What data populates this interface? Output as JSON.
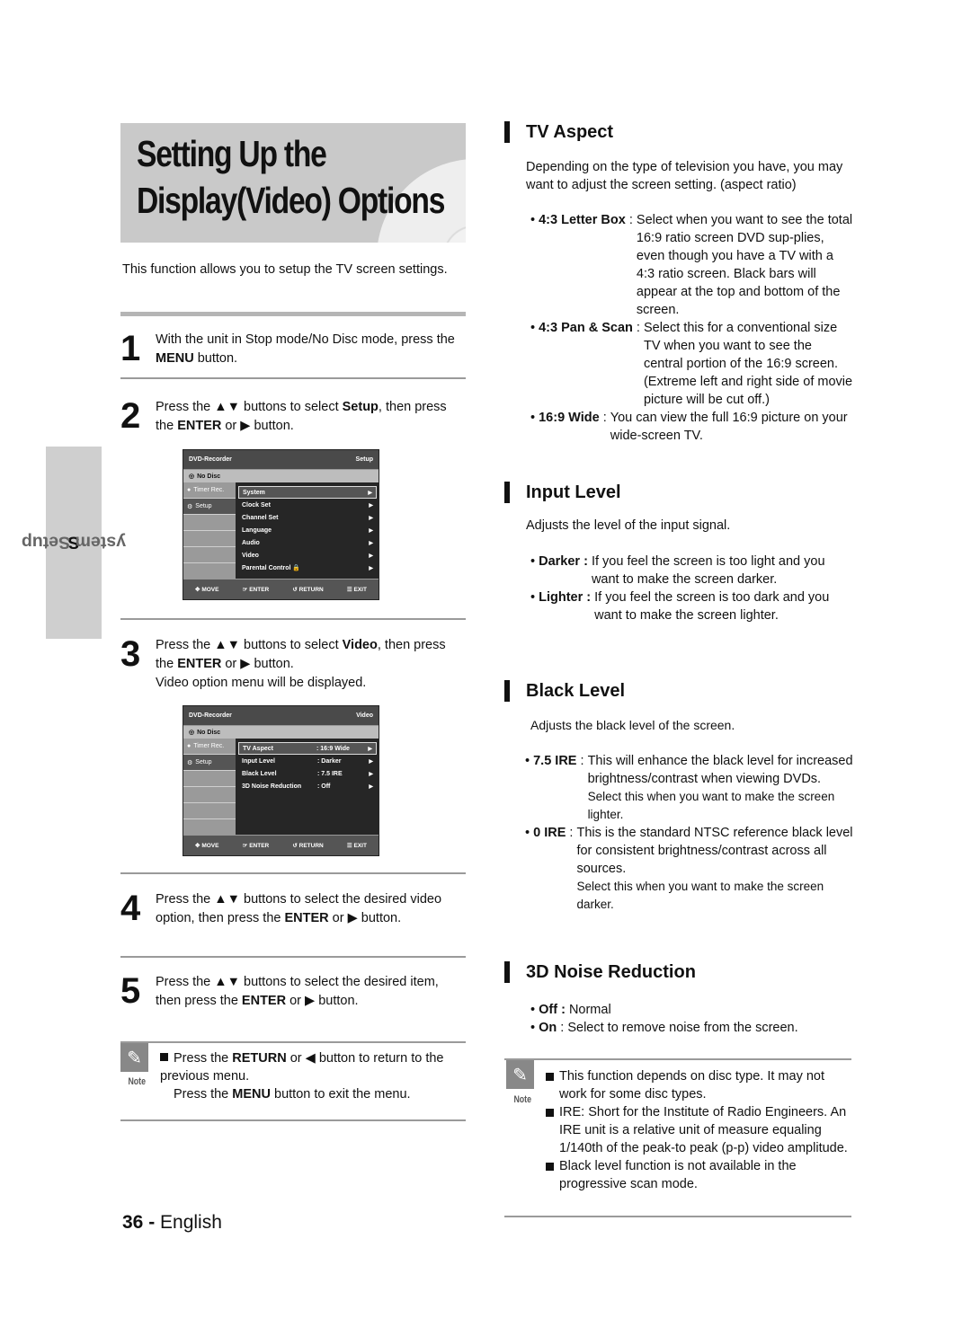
{
  "title": {
    "line1": "Setting Up the",
    "line2": "Display(Video) Options"
  },
  "intro": "This function allows you to setup the TV screen settings.",
  "side_tab": {
    "first_letter": "S",
    "rest": "ystem Setup"
  },
  "steps": [
    {
      "num": "1",
      "parts": [
        [
          "With the unit in Stop mode/No Disc mode, press the ",
          false
        ],
        [
          "MENU",
          true
        ],
        [
          " button.",
          false
        ]
      ]
    },
    {
      "num": "2",
      "parts": [
        [
          "Press the ▲▼ buttons to select ",
          false
        ],
        [
          "Setup",
          true
        ],
        [
          ", then press the ",
          false
        ],
        [
          "ENTER",
          true
        ],
        [
          " or ▶ button.",
          false
        ]
      ]
    },
    {
      "num": "3",
      "parts": [
        [
          "Press the ▲▼ buttons to select ",
          false
        ],
        [
          "Video",
          true
        ],
        [
          ", then press the ",
          false
        ],
        [
          "ENTER",
          true
        ],
        [
          " or ▶ button.",
          false
        ]
      ],
      "extra": "Video option menu will be displayed."
    },
    {
      "num": "4",
      "parts": [
        [
          "Press the ▲▼ buttons to select the desired video option, then press the ",
          false
        ],
        [
          "ENTER",
          true
        ],
        [
          " or ▶ button.",
          false
        ]
      ]
    },
    {
      "num": "5",
      "parts": [
        [
          "Press the ▲▼ buttons to select the desired item, then press the ",
          false
        ],
        [
          "ENTER",
          true
        ],
        [
          " or ▶ button.",
          false
        ]
      ]
    }
  ],
  "osd_setup": {
    "header_left": "DVD-Recorder",
    "header_right": "Setup",
    "disc_status": "No Disc",
    "left_items": [
      "Timer Rec.",
      "Setup"
    ],
    "items": [
      {
        "label": "System",
        "value": "",
        "selected": true
      },
      {
        "label": "Clock Set",
        "value": ""
      },
      {
        "label": "Channel Set",
        "value": ""
      },
      {
        "label": "Language",
        "value": ""
      },
      {
        "label": "Audio",
        "value": ""
      },
      {
        "label": "Video",
        "value": ""
      },
      {
        "label": "Parental Control 🔒",
        "value": ""
      }
    ],
    "footer": [
      "MOVE",
      "ENTER",
      "RETURN",
      "EXIT"
    ]
  },
  "osd_video": {
    "header_left": "DVD-Recorder",
    "header_right": "Video",
    "disc_status": "No Disc",
    "left_items": [
      "Timer Rec.",
      "Setup"
    ],
    "items": [
      {
        "label": "TV Aspect",
        "value": ": 16:9 Wide",
        "selected": true
      },
      {
        "label": "Input Level",
        "value": ": Darker"
      },
      {
        "label": "Black Level",
        "value": ": 7.5 IRE"
      },
      {
        "label": "3D Noise Reduction",
        "value": ": Off"
      }
    ],
    "footer": [
      "MOVE",
      "ENTER",
      "RETURN",
      "EXIT"
    ]
  },
  "note_left": {
    "label": "Note",
    "lines": [
      [
        [
          "Press the ",
          false
        ],
        [
          "RETURN",
          true
        ],
        [
          " or ◀ button to return to the previous menu.",
          false
        ]
      ],
      [
        [
          "Press the ",
          false
        ],
        [
          "MENU",
          true
        ],
        [
          " button to exit the menu.",
          false
        ]
      ]
    ]
  },
  "tv_aspect": {
    "heading": "TV Aspect",
    "intro": "Depending on the type of television you have, you may want to adjust the screen setting. (aspect ratio)",
    "options": [
      {
        "term": "4:3 Letter Box",
        "desc": "Select when you want to see the total 16:9 ratio screen DVD sup-plies, even though you have a TV with a 4:3 ratio screen. Black bars will appear at the top and bottom of the screen."
      },
      {
        "term": "4:3 Pan & Scan",
        "desc": "Select this for a conventional size TV when you want to see the central portion of the 16:9 screen. (Extreme left and right side of movie picture will be cut off.)"
      },
      {
        "term": "16:9 Wide",
        "desc": "You can view the full 16:9 picture on your wide-screen TV."
      }
    ]
  },
  "input_level": {
    "heading": "Input Level",
    "intro": "Adjusts the level of the input signal.",
    "options": [
      {
        "term": "Darker :",
        "desc": "If you feel the screen is too light and you want to make the screen darker."
      },
      {
        "term": "Lighter :",
        "desc": "If you feel the screen is too dark and you want to make the screen lighter."
      }
    ]
  },
  "black_level": {
    "heading": "Black Level",
    "intro": "Adjusts the black level of the screen.",
    "options": [
      {
        "term": "7.5 IRE",
        "desc": "This will  enhance the black level for increased brightness/contrast when viewing DVDs.",
        "sub": "Select this when you want to make the screen lighter."
      },
      {
        "term": "0 IRE",
        "desc": "This is the standard NTSC reference black level for consistent brightness/contrast across all sources.",
        "sub": "Select this when you want to make the screen darker."
      }
    ]
  },
  "noise_reduction": {
    "heading": "3D Noise Reduction",
    "options": [
      {
        "term": "Off :",
        "desc": "Normal"
      },
      {
        "term": "On",
        "desc": ": Select to remove noise from the screen."
      }
    ]
  },
  "note_right": {
    "label": "Note",
    "items": [
      "This function depends on disc type. It may not work for some disc types.",
      "IRE: Short for the Institute of Radio Engineers.  An IRE unit is a relative unit of measure equaling 1/140th of the peak-to peak (p-p) video amplitude.",
      "Black level function is not available in the progressive scan mode."
    ]
  },
  "footer": {
    "page": "36 -",
    "language": "English"
  }
}
